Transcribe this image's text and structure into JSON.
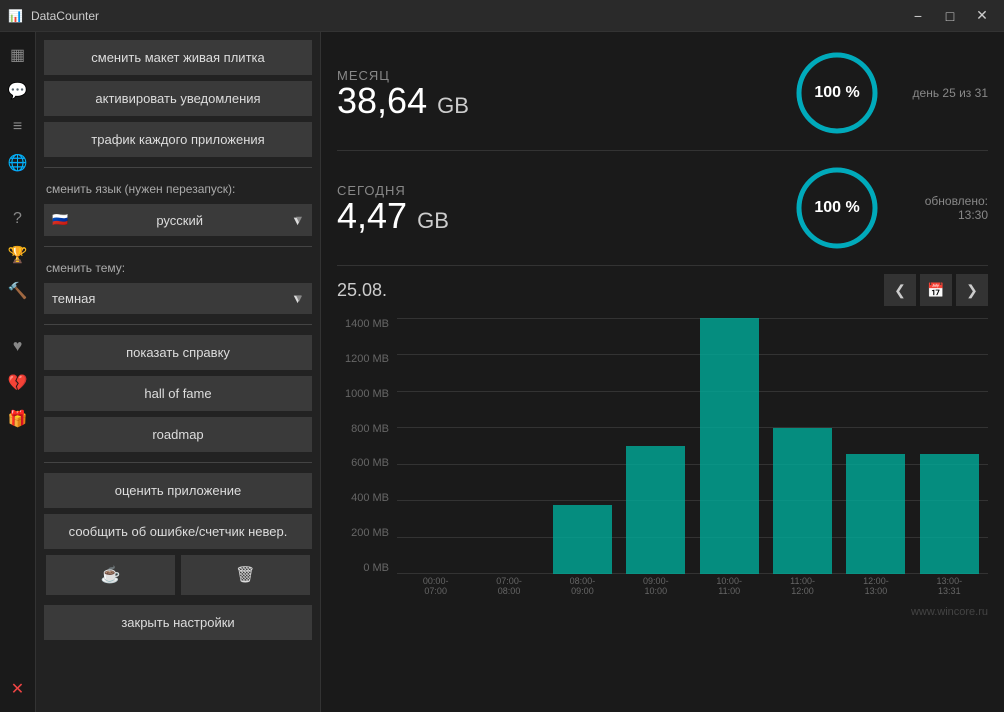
{
  "titleBar": {
    "appName": "DataCounter",
    "minimize": "−",
    "maximize": "□",
    "close": "✕"
  },
  "iconBar": {
    "icons": [
      "▦",
      "💬",
      "≡",
      "?",
      "⬡",
      "☆",
      "🔨",
      "♥",
      "💔",
      "🎁"
    ],
    "bottomIcon": "✕"
  },
  "sidebar": {
    "btn1": "сменить макет живая плитка",
    "btn2": "активировать уведомления",
    "btn3": "трафик каждого приложения",
    "languageLabel": "сменить язык (нужен перезапуск):",
    "languageValue": "русский",
    "themeLabel": "сменить тему:",
    "themeValue": "темная",
    "btn4": "показать справку",
    "btn5": "hall of fame",
    "btn6": "roadmap",
    "btn7": "оценить приложение",
    "btn8": "сообщить об ошибке/счетчик невер.",
    "closeBtn": "закрыть настройки"
  },
  "stats": {
    "monthLabel": "МЕСЯЦ",
    "monthValue": "38,64",
    "monthUnit": "GB",
    "monthPercent": 100,
    "monthInfo": "день 25 из 31",
    "todayLabel": "СЕГОДНЯ",
    "todayValue": "4,47",
    "todayUnit": "GB",
    "todayPercent": 100,
    "todayInfo1": "обновлено:",
    "todayInfo2": "13:30"
  },
  "chart": {
    "dateLabel": "25.08.",
    "yLabels": [
      "1400 MB",
      "1200 MB",
      "1000 MB",
      "800 MB",
      "600 MB",
      "400 MB",
      "200 MB",
      "0 MB"
    ],
    "xLabels": [
      "00:00-\n07:00",
      "07:00-\n08:00",
      "08:00-\n09:00",
      "09:00-\n10:00",
      "10:00-\n11:00",
      "11:00-\n12:00",
      "12:00-\n13:00",
      "13:00-\n13:31"
    ],
    "bars": [
      0,
      0,
      27,
      50,
      100,
      57,
      47,
      47
    ],
    "maxMB": 1400,
    "navPrev": "❮",
    "navCalendar": "📅",
    "navNext": "❯"
  },
  "watermark": "www.wincore.ru"
}
